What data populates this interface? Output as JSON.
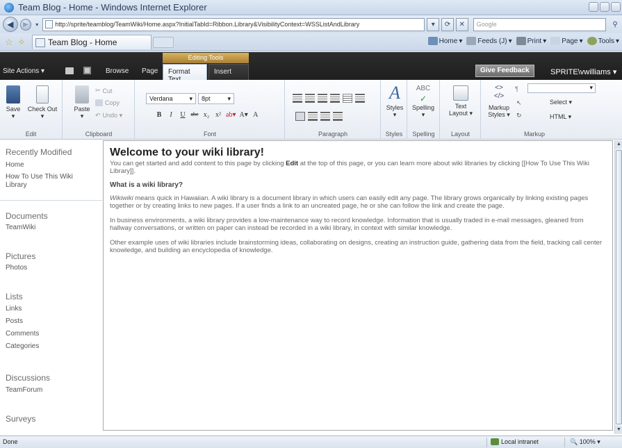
{
  "window": {
    "title": "Team Blog - Home - Windows Internet Explorer"
  },
  "addressbar": {
    "url": "http://sprite/teamblog/TeamWiki/Home.aspx?InitialTabId=Ribbon.Library&VisibilityContext=WSSListAndLibrary",
    "search_placeholder": "Google"
  },
  "tabs": [
    {
      "label": "Team Blog - Home"
    }
  ],
  "command_bar": {
    "home": "Home",
    "feeds": "Feeds (J)",
    "print": "Print",
    "page": "Page",
    "tools": "Tools"
  },
  "sp_topbar": {
    "site_actions": "Site Actions ▾",
    "browse": "Browse",
    "page": "Page",
    "editing_tools": "Editing Tools",
    "format_text": "Format Text",
    "insert": "Insert",
    "give_feedback": "Give Feedback",
    "user": "SPRITE\\vwilliams ▾"
  },
  "ribbon": {
    "edit": {
      "save": "Save",
      "check_out": "Check Out",
      "label": "Edit"
    },
    "clipboard": {
      "paste": "Paste",
      "cut": "Cut",
      "copy": "Copy",
      "undo": "Undo ▾",
      "label": "Clipboard"
    },
    "font": {
      "family": "Verdana",
      "size": "8pt",
      "label": "Font"
    },
    "paragraph": {
      "label": "Paragraph"
    },
    "styles": {
      "btn": "Styles",
      "label": "Styles"
    },
    "spelling": {
      "btn": "Spelling",
      "label": "Spelling"
    },
    "layout": {
      "btn": "Text Layout ▾",
      "label": "Layout"
    },
    "markup": {
      "styles": "Markup Styles ▾",
      "select": "Select ▾",
      "html": "HTML ▾",
      "label": "Markup"
    }
  },
  "leftnav": {
    "recent": {
      "title": "Recently Modified",
      "items": [
        "Home",
        "How To Use This Wiki Library"
      ]
    },
    "documents": {
      "title": "Documents",
      "items": [
        "TeamWiki"
      ]
    },
    "pictures": {
      "title": "Pictures",
      "items": [
        "Photos"
      ]
    },
    "lists": {
      "title": "Lists",
      "items": [
        "Links",
        "Posts",
        "Comments",
        "Categories"
      ]
    },
    "discussions": {
      "title": "Discussions",
      "items": [
        "TeamForum"
      ]
    },
    "surveys": {
      "title": "Surveys"
    }
  },
  "content": {
    "heading": "Welcome to your wiki library!",
    "intro_1": "You can get started and add content to this page by clicking ",
    "intro_bold": "Edit",
    "intro_2": " at the top of this page, or you can learn more about wiki libraries by clicking [[How To Use This Wiki Library]].",
    "question": "What is a wiki library?",
    "p1_em": "Wikiwiki",
    "p1": " means quick in Hawaiian. A wiki library is a document library in which users can easily edit any page. The library grows organically by linking existing pages together or by creating links to new pages. If a user finds a link to an uncreated page, he or she can follow the link and create the page.",
    "p2": "In business environments, a wiki library provides a low-maintenance way to record knowledge. Information that is usually traded in e-mail messages, gleaned from hallway conversations, or written on paper can instead be recorded in a wiki library, in context with similar knowledge.",
    "p3": "Other example uses of wiki libraries include brainstorming ideas, collaborating on designs, creating an instruction guide, gathering data from the field, tracking call center knowledge, and building an encyclopedia of knowledge."
  },
  "statusbar": {
    "status": "Done",
    "zone": "Local intranet",
    "zoom": "100%"
  }
}
